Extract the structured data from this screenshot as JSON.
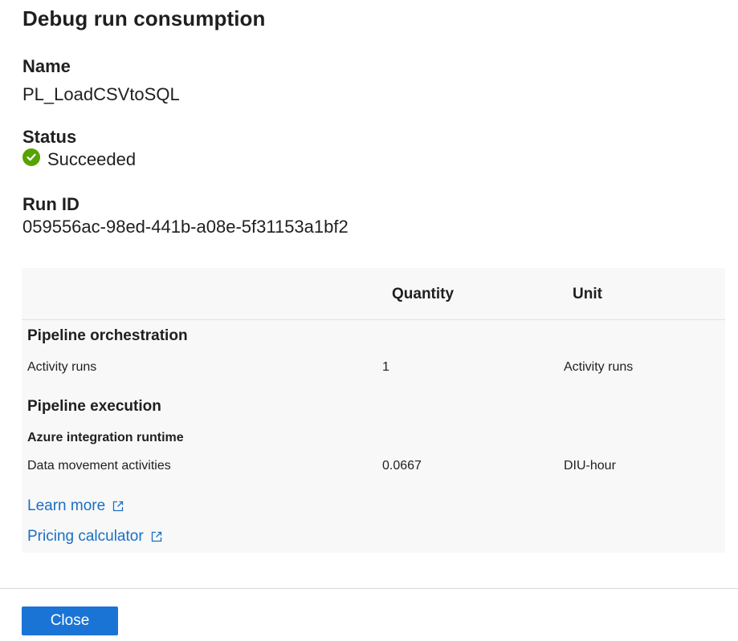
{
  "dialog": {
    "title": "Debug run consumption"
  },
  "fields": {
    "name_label": "Name",
    "name_value": "PL_LoadCSVtoSQL",
    "status_label": "Status",
    "status_value": "Succeeded",
    "status_icon": "check-circle-icon",
    "status_color": "#57a300",
    "run_id_label": "Run ID",
    "run_id_value": "059556ac-98ed-441b-a08e-5f31153a1bf2"
  },
  "table": {
    "columns": [
      "",
      "Quantity",
      "Unit"
    ],
    "sections": [
      {
        "title": "Pipeline orchestration",
        "rows": [
          {
            "name": "Activity runs",
            "quantity": "1",
            "unit": "Activity runs"
          }
        ]
      },
      {
        "title": "Pipeline execution",
        "subtitle": "Azure integration runtime",
        "rows": [
          {
            "name": "Data movement activities",
            "quantity": "0.0667",
            "unit": "DIU-hour"
          }
        ]
      }
    ]
  },
  "links": {
    "learn_more": "Learn more",
    "pricing_calculator": "Pricing calculator",
    "icon": "external-link-icon",
    "color": "#1a6fc4"
  },
  "footer": {
    "close_label": "Close",
    "accent": "#1a74d6"
  }
}
